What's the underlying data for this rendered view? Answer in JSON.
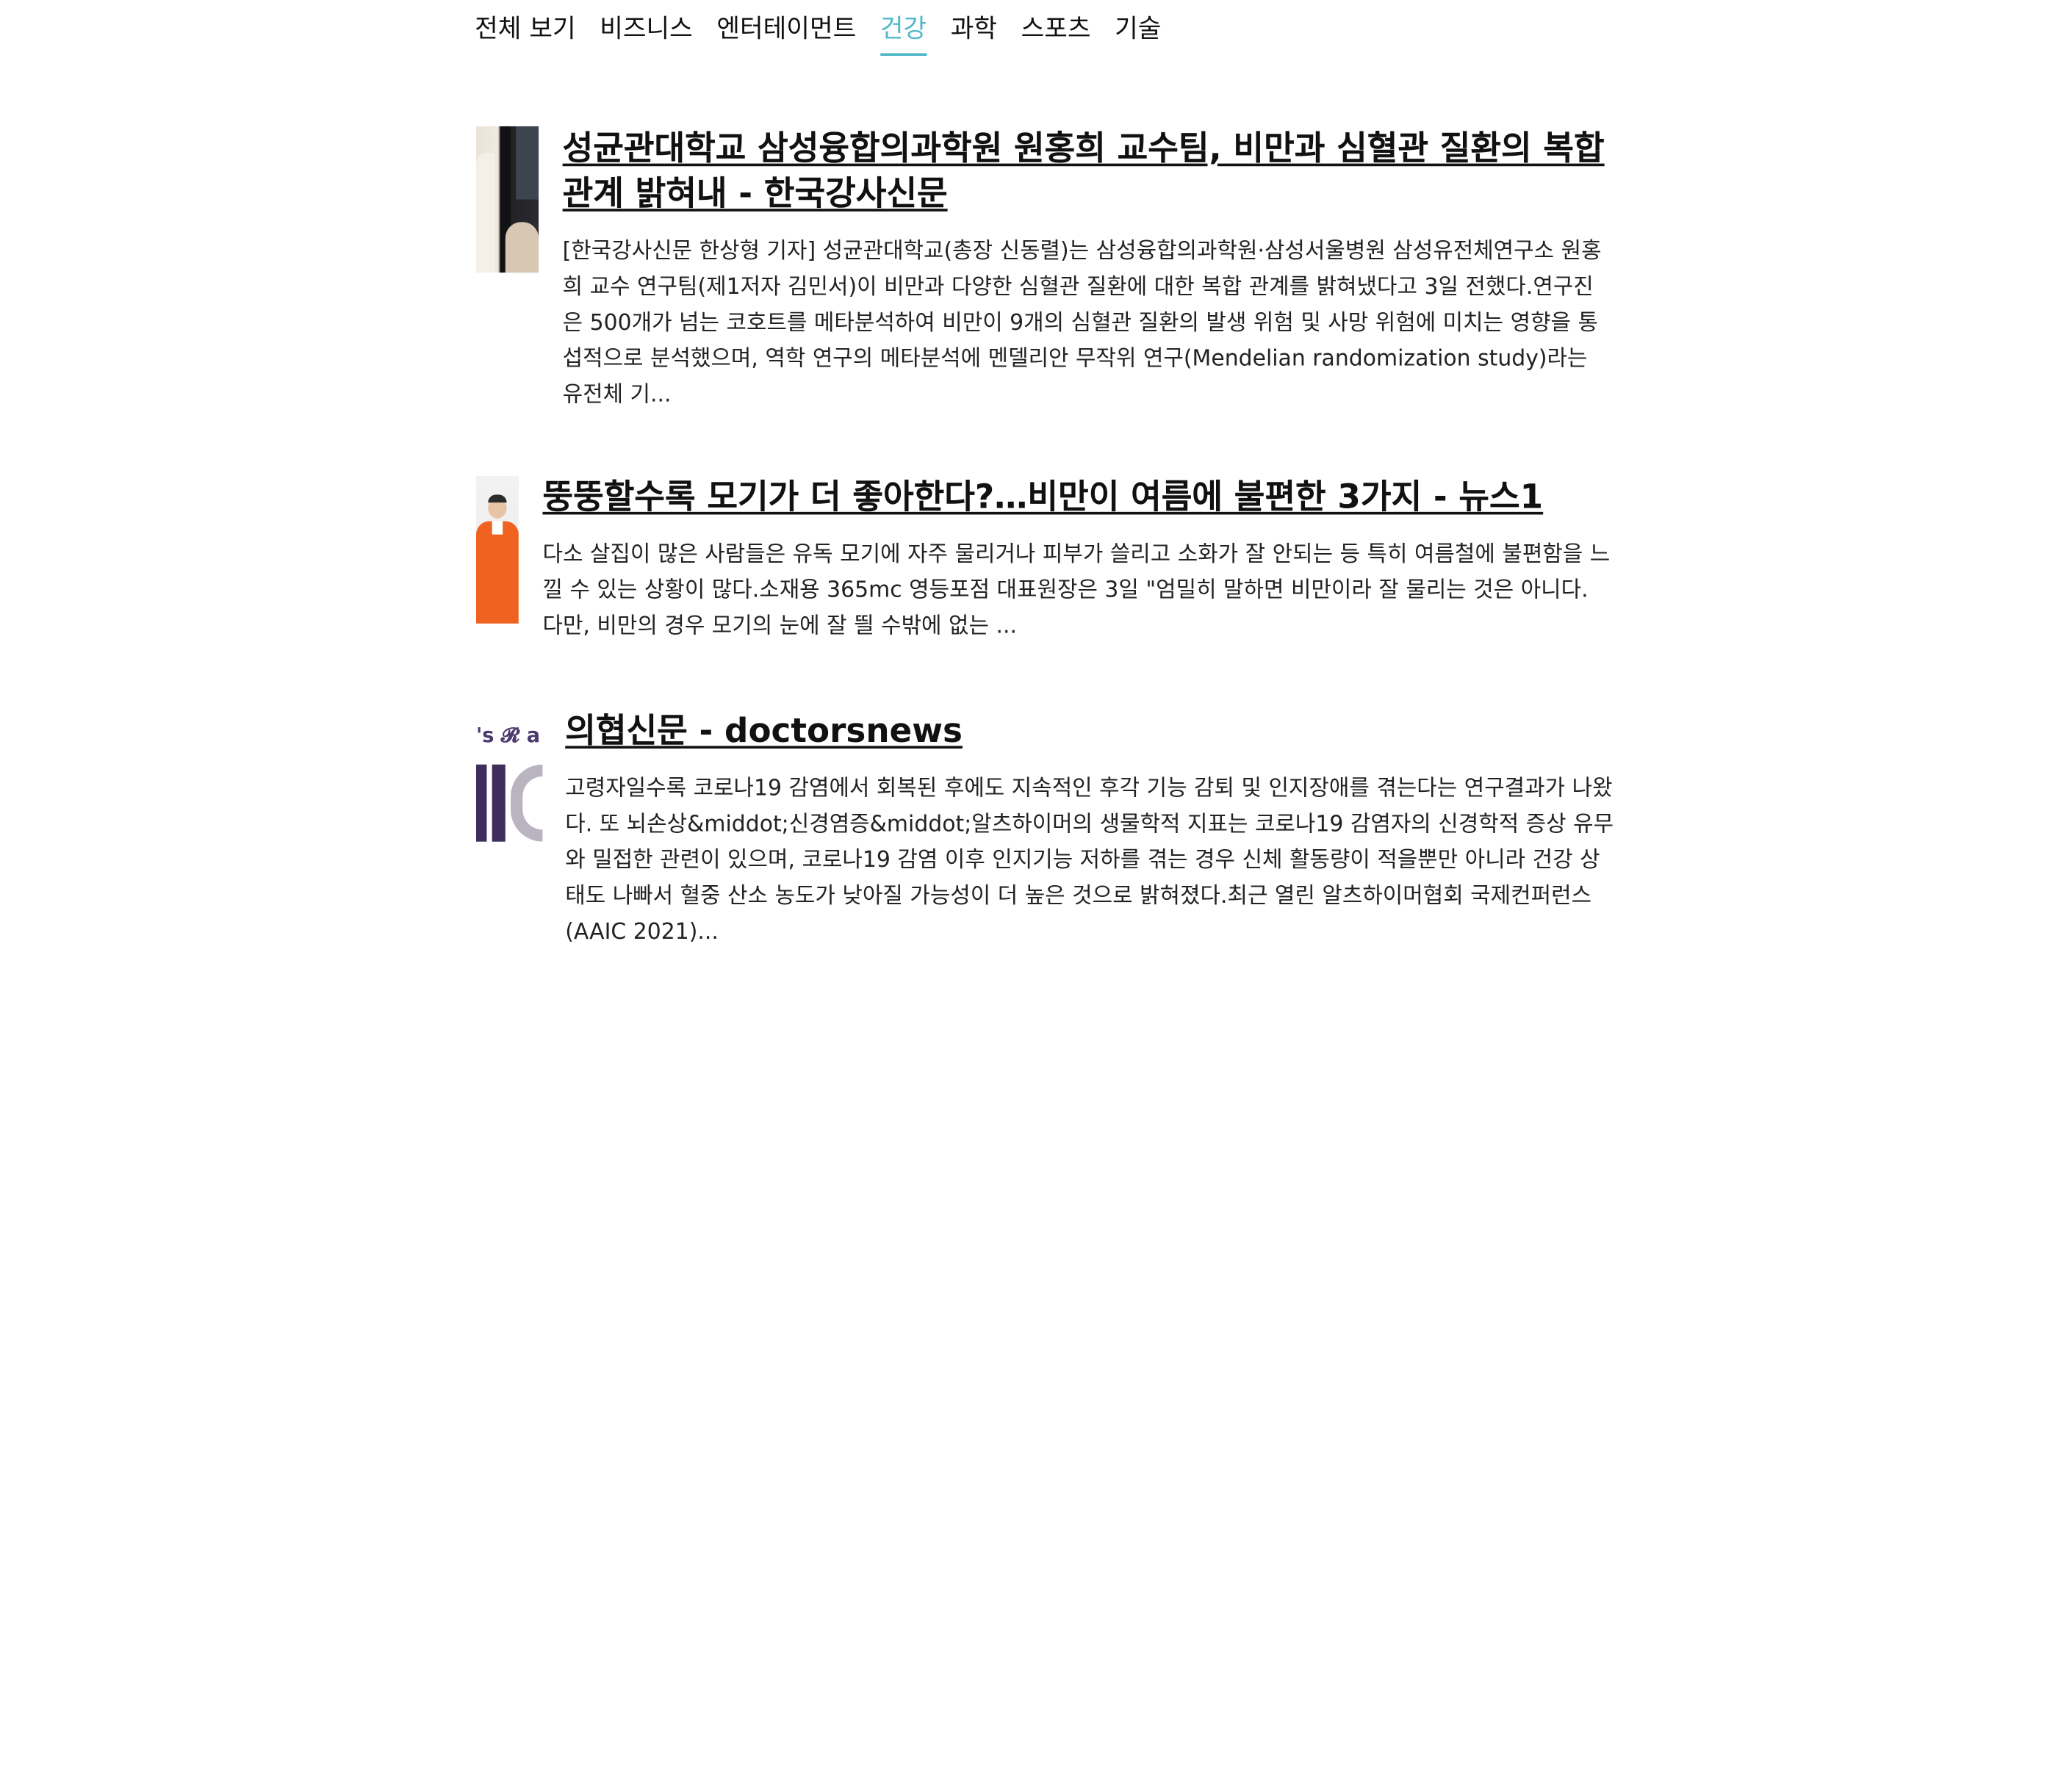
{
  "nav": {
    "tabs": [
      {
        "label": "전체 보기",
        "active": false
      },
      {
        "label": "비즈니스",
        "active": false
      },
      {
        "label": "엔터테이먼트",
        "active": false
      },
      {
        "label": "건강",
        "active": true
      },
      {
        "label": "과학",
        "active": false
      },
      {
        "label": "스포츠",
        "active": false
      },
      {
        "label": "기술",
        "active": false
      }
    ],
    "active_color": "#4fb8c9"
  },
  "articles": [
    {
      "title": "성균관대학교 삼성융합의과학원 원홍희 교수팀, 비만과 심혈관 질환의 복합 관계 밝혀내 - 한국강사신문",
      "summary": "[한국강사신문 한상형 기자] 성균관대학교(총장 신동렬)는 삼성융합의과학원·삼성서울병원 삼성유전체연구소 원홍희 교수 연구팀(제1저자 김민서)이 비만과 다양한 심혈관 질환에 대한 복합 관계를 밝혀냈다고 3일 전했다.연구진은 500개가 넘는 코호트를 메타분석하여 비만이 9개의 심혈관 질환의 발생 위험 및 사망 위험에 미치는 영향을 통섭적으로 분석했으며, 역학 연구의 메타분석에 멘델리안 무작위 연구(Mendelian randomization study)라는 유전체 기...",
      "thumbnail": "portrait-photo"
    },
    {
      "title": "뚱뚱할수록 모기가 더 좋아한다?…비만이 여름에 불편한 3가지 - 뉴스1",
      "summary": "다소 살집이 많은 사람들은 유독 모기에 자주 물리거나 피부가 쓸리고 소화가 잘 안되는 등 특히 여름철에 불편함을 느낄 수 있는 상황이 많다.소재용 365mc 영등포점 대표원장은 3일 \"엄밀히 말하면 비만이라 잘 물리는 것은 아니다. 다만, 비만의 경우 모기의 눈에 잘 띌 수밖에 없는 ...",
      "thumbnail": "doctor-photo"
    },
    {
      "title": "의협신문 - doctorsnews",
      "summary": "고령자일수록 코로나19 감염에서 회복된 후에도 지속적인 후각 기능 감퇴 및 인지장애를 겪는다는 연구결과가 나왔다. 또 뇌손상&middot;신경염증&middot;알츠하이머의 생물학적 지표는 코로나19 감염자의 신경학적 증상 유무와 밀접한 관련이 있으며, 코로나19 감염 이후 인지기능 저하를 겪는 경우 신체 활동량이 적을뿐만 아니라 건강 상태도 나빠서 혈중 산소 농도가 낮아질 가능성이 더 높은 것으로 밝혀졌다.최근 열린 알츠하이머협회 국제컨퍼런스(AAIC 2021)...",
      "thumbnail": "logo-image",
      "thumbnail_text": "'s 𝓡 a"
    }
  ]
}
